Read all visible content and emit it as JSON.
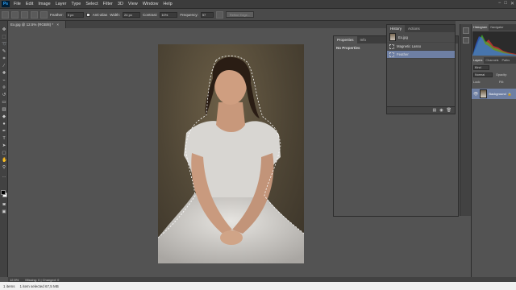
{
  "app": {
    "logo": "Ps"
  },
  "menu": [
    "File",
    "Edit",
    "Image",
    "Layer",
    "Type",
    "Select",
    "Filter",
    "3D",
    "View",
    "Window",
    "Help"
  ],
  "window_controls": [
    "−",
    "□",
    "✕"
  ],
  "options_bar": {
    "feather_label": "Feather:",
    "feather_value": "0 px",
    "antialias_label": "Anti-alias",
    "width_label": "Width:",
    "width_value": "24 px",
    "contrast_label": "Contrast:",
    "contrast_value": "10%",
    "frequency_label": "Frequency:",
    "frequency_value": "57",
    "refine_button": "Refine Edge..."
  },
  "document_tab": {
    "title": "Ex.jpg @ 12.5% (RGB/8) *",
    "close": "×"
  },
  "properties_panel": {
    "tabs": [
      "Properties",
      "Info"
    ],
    "message": "No Properties"
  },
  "history_panel": {
    "tabs": [
      "History",
      "Actions"
    ],
    "items": [
      {
        "label": "Ex.jpg",
        "type": "snapshot"
      },
      {
        "label": "Magnetic Lasso",
        "type": "state"
      },
      {
        "label": "Feather",
        "type": "state",
        "selected": true
      }
    ]
  },
  "right_panels": {
    "top_tabs": [
      "Histogram",
      "Navigator"
    ],
    "layer_tabs": [
      "Layers",
      "Channels",
      "Paths"
    ],
    "kind_label": "Kind",
    "blend_mode": "Normal",
    "opacity_label": "Opacity:",
    "lock_label": "Lock:",
    "fill_label": "Fill:",
    "layer_name": "Background"
  },
  "status_bar": {
    "zoom": "12.5%",
    "info": "Missing: 0 | Changed: 0"
  },
  "taskbar": {
    "items": [
      "1 items",
      "1 item selected  67,5 MB"
    ]
  },
  "colors": {
    "selection_row": "#6e7fa3",
    "panel_bg": "#535353",
    "menu_bg": "#3c3c3c"
  }
}
